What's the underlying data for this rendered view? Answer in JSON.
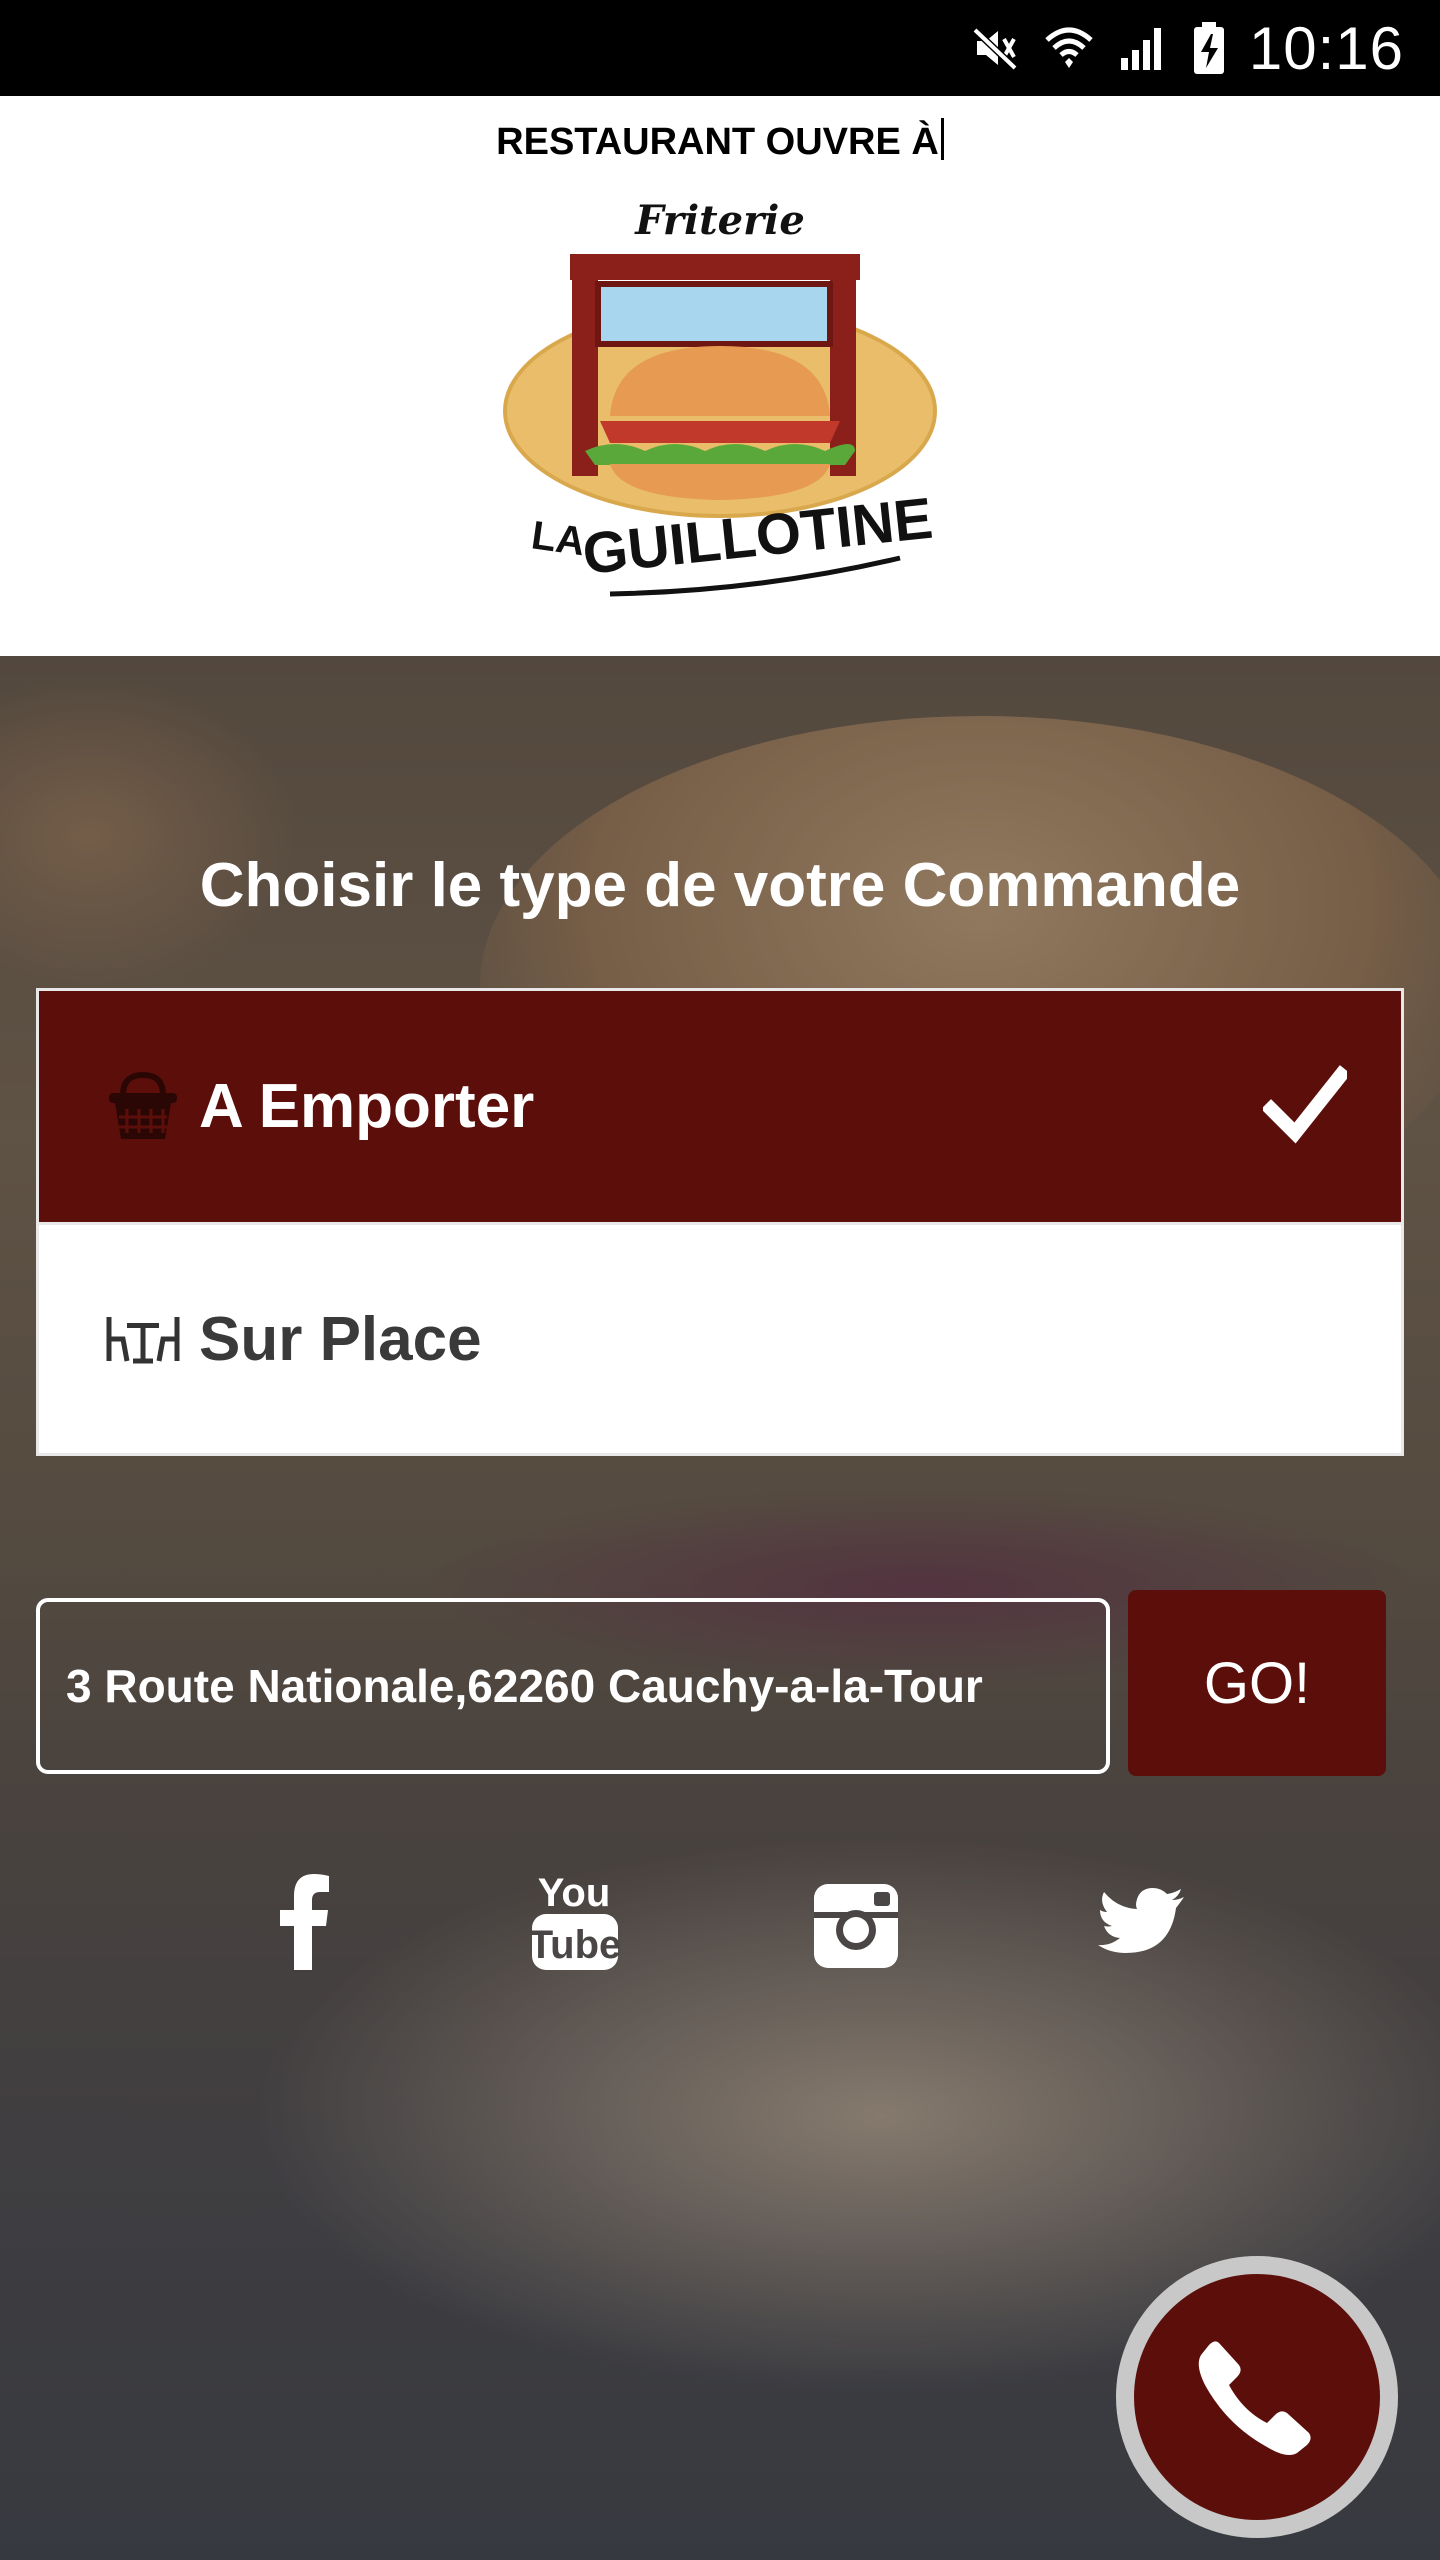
{
  "status_bar": {
    "time": "10:16",
    "icons": [
      "mute-icon",
      "wifi-icon",
      "signal-icon",
      "battery-charging-icon"
    ]
  },
  "header": {
    "open_text": "RESTAURANT OUVRE À",
    "logo": {
      "top_text": "Friterie",
      "brand_la": "LA",
      "brand_name": "GUILLOTINE"
    }
  },
  "order": {
    "title": "Choisir le type de votre Commande",
    "options": [
      {
        "label": "A Emporter",
        "icon": "basket-icon",
        "selected": true
      },
      {
        "label": "Sur Place",
        "icon": "table-chairs-icon",
        "selected": false
      }
    ]
  },
  "address": {
    "value": "3 Route Nationale,62260 Cauchy-a-la-Tour",
    "go_label": "GO!"
  },
  "social": [
    "facebook-icon",
    "youtube-icon",
    "instagram-icon",
    "twitter-icon"
  ],
  "youtube_text": {
    "you": "You",
    "tube": "Tube"
  },
  "colors": {
    "accent": "#5c0f0a",
    "status_bar": "#000000",
    "text_light": "#ffffff"
  }
}
